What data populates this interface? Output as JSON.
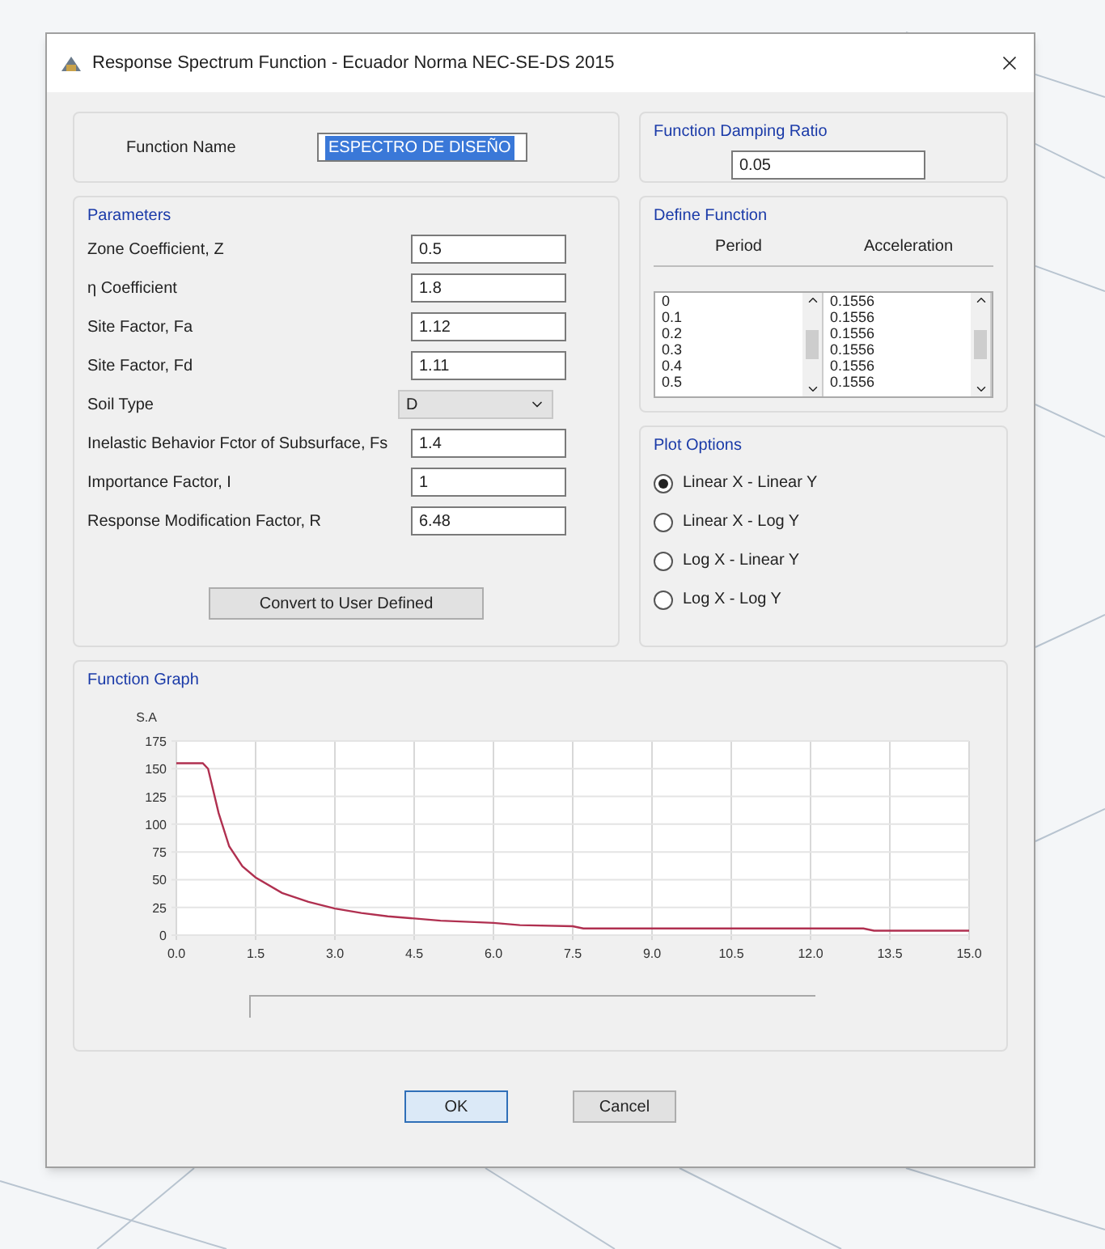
{
  "window": {
    "title": "Response Spectrum Function - Ecuador Norma NEC-SE-DS 2015"
  },
  "function_name": {
    "label": "Function Name",
    "value": "ESPECTRO DE DISEÑO",
    "highlighted": true
  },
  "damping": {
    "title": "Function Damping Ratio",
    "value": "0.05"
  },
  "parameters": {
    "title": "Parameters",
    "fields": [
      {
        "label": "Zone Coefficient, Z",
        "value": "0.5",
        "kind": "text"
      },
      {
        "label": "η Coefficient",
        "value": "1.8",
        "kind": "text"
      },
      {
        "label": "Site Factor, Fa",
        "value": "1.12",
        "kind": "text"
      },
      {
        "label": "Site Factor, Fd",
        "value": "1.11",
        "kind": "text"
      },
      {
        "label": "Soil Type",
        "value": "D",
        "kind": "select"
      },
      {
        "label": "Inelastic Behavior Fctor of Subsurface, Fs",
        "value": "1.4",
        "kind": "text"
      },
      {
        "label": "Importance Factor, I",
        "value": "1",
        "kind": "text"
      },
      {
        "label": "Response Modification Factor, R",
        "value": "6.48",
        "kind": "text"
      }
    ]
  },
  "convert_button": "Convert to User Defined",
  "define_function": {
    "title": "Define Function",
    "columns": [
      "Period",
      "Acceleration"
    ],
    "periods": [
      "0",
      "0.1",
      "0.2",
      "0.3",
      "0.4",
      "0.5"
    ],
    "accelerations": [
      "0.1556",
      "0.1556",
      "0.1556",
      "0.1556",
      "0.1556",
      "0.1556"
    ]
  },
  "plot_options": {
    "title": "Plot Options",
    "options": [
      {
        "label": "Linear X - Linear Y",
        "selected": true
      },
      {
        "label": "Linear X - Log Y",
        "selected": false
      },
      {
        "label": "Log X - Linear Y",
        "selected": false
      },
      {
        "label": "Log X - Log Y",
        "selected": false
      }
    ]
  },
  "function_graph": {
    "title": "Function Graph",
    "chart_data": {
      "type": "line",
      "ylabel": "S.A",
      "x": [
        0,
        0.5,
        0.6,
        0.8,
        1,
        1.25,
        1.5,
        2,
        2.5,
        3,
        3.5,
        4,
        4.5,
        5,
        6,
        6.5,
        7.5,
        7.7,
        9,
        12,
        13,
        13.2,
        15
      ],
      "grid": true,
      "series": [
        {
          "color": "#b03050",
          "values": [
            155,
            155,
            150,
            110,
            80,
            62,
            52,
            38,
            30,
            24,
            20,
            17,
            15,
            13,
            11,
            9,
            8,
            6,
            6,
            6,
            6,
            4,
            4
          ]
        }
      ],
      "xlim": [
        0,
        15
      ],
      "ylim": [
        0,
        175
      ],
      "xticks": [
        {
          "value": 0,
          "label": "0.0"
        },
        {
          "value": 1.5,
          "label": "1.5"
        },
        {
          "value": 3,
          "label": "3.0"
        },
        {
          "value": 4.5,
          "label": "4.5"
        },
        {
          "value": 6,
          "label": "6.0"
        },
        {
          "value": 7.5,
          "label": "7.5"
        },
        {
          "value": 9,
          "label": "9.0"
        },
        {
          "value": 10.5,
          "label": "10.5"
        },
        {
          "value": 12,
          "label": "12.0"
        },
        {
          "value": 13.5,
          "label": "13.5"
        },
        {
          "value": 15,
          "label": "15.0"
        }
      ],
      "yticks": [
        0,
        25,
        50,
        75,
        100,
        125,
        150,
        175
      ]
    }
  },
  "buttons": [
    {
      "label": "OK",
      "focused": true
    },
    {
      "label": "Cancel",
      "focused": false
    }
  ]
}
